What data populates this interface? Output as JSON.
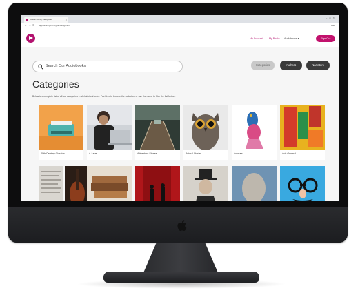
{
  "browser": {
    "tab_title": "Online Guru | Categories",
    "url": "app.onlineguru.org.uk/categories",
    "user": "Paul"
  },
  "header": {
    "nav": {
      "my_account": "My Account",
      "my_books": "My Books",
      "audiobooks": "Audiobooks ▾"
    },
    "sign_out": "Sign Out",
    "brand_color": "#b3126f"
  },
  "search": {
    "placeholder": "Search Our Audiobooks"
  },
  "filters": {
    "categories": "Categories",
    "authors": "Authors",
    "narrators": "Narrators"
  },
  "page": {
    "title": "Categories",
    "intro": "Below is a complete list of all our categories in alphabetical order. Feel free to browse the collection or use the menu to filter the list further."
  },
  "categories_row1": [
    {
      "label": "20th Century Classics",
      "image": "typewriter"
    },
    {
      "label": "A-Level",
      "image": "student-with-laptop"
    },
    {
      "label": "Adventure Stories",
      "image": "forest-rope-bridge"
    },
    {
      "label": "Animal Stories",
      "image": "owl"
    },
    {
      "label": "Animals",
      "image": "fish-painting"
    },
    {
      "label": "Arts General",
      "image": "colorful-art"
    }
  ],
  "categories_row2": [
    {
      "image": "newspaper-print"
    },
    {
      "image": "violin"
    },
    {
      "image": "old-books"
    },
    {
      "image": "theatre-red-curtain"
    },
    {
      "image": "victorian-portrait"
    },
    {
      "image": "stone-statue-head"
    },
    {
      "image": "novelty-glasses-disguise"
    }
  ]
}
